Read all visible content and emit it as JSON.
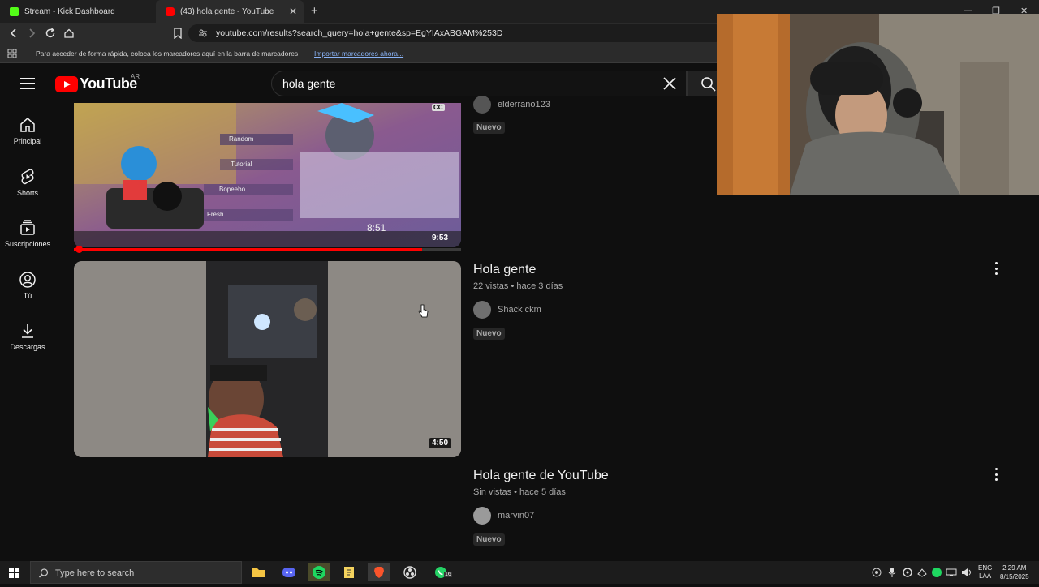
{
  "browser": {
    "tabs": [
      {
        "label": "Stream - Kick Dashboard",
        "favicon_color": "#53fc18",
        "active": false
      },
      {
        "label": "(43) hola gente - YouTube",
        "favicon_color": "#ff0000",
        "active": true
      }
    ],
    "tab_close_glyph": "✕",
    "new_tab_glyph": "+",
    "url": "youtube.com/results?search_query=hola+gente&sp=EgYIAxABGAM%253D",
    "bookmarks_hint": "Para acceder de forma rápida, coloca los marcadores aquí en la barra de marcadores",
    "bookmarks_import": "Importar marcadores ahora..."
  },
  "youtube": {
    "logo_text": "YouTube",
    "country": "AR",
    "search_query": "hola gente",
    "sidebar": [
      {
        "label": "Principal",
        "icon": "home-icon"
      },
      {
        "label": "Shorts",
        "icon": "shorts-icon"
      },
      {
        "label": "Suscripciones",
        "icon": "subscriptions-icon"
      },
      {
        "label": "Tú",
        "icon": "you-icon"
      },
      {
        "label": "Descargas",
        "icon": "download-icon"
      }
    ],
    "results": [
      {
        "title": "",
        "channel": "elderrano123",
        "badge": "Nuevo",
        "duration": "9:53",
        "cc_badge": "CC",
        "watch_progress": 0.9,
        "overlay": {
          "menu_items": [
            "Random",
            "Tutorial",
            "Bopeebo",
            "Fresh"
          ],
          "time": "8:51"
        }
      },
      {
        "title": "Hola gente",
        "meta": "22 vistas • hace 3 días",
        "channel": "Shack ckm",
        "badge": "Nuevo",
        "duration": "4:50"
      },
      {
        "title": "Hola gente de YouTube",
        "meta": "Sin vistas • hace 5 días",
        "channel": "marvin07",
        "badge": "Nuevo"
      }
    ]
  },
  "taskbar": {
    "search_placeholder": "Type here to search",
    "whatsapp_badge": "16",
    "lang_top": "ENG",
    "lang_bottom": "LAA",
    "time": "2:29 AM",
    "date": "8/15/2025"
  },
  "colors": {
    "yt_red": "#ff0000",
    "kick_green": "#53fc18",
    "bg": "#0f0f0f"
  }
}
